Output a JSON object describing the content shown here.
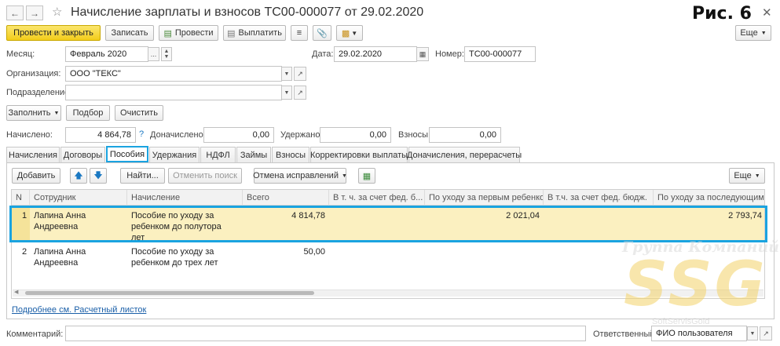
{
  "window": {
    "title": "Начисление зарплаты и взносов ТС00-000077 от 29.02.2020",
    "figure_label": "Рис. 6"
  },
  "toolbar": {
    "post_close": "Провести и закрыть",
    "save": "Записать",
    "post": "Провести",
    "pay": "Выплатить",
    "more": "Еще"
  },
  "header": {
    "month_label": "Месяц:",
    "month_value": "Февраль 2020",
    "date_label": "Дата:",
    "date_value": "29.02.2020",
    "number_label": "Номер:",
    "number_value": "ТС00-000077",
    "org_label": "Организация:",
    "org_value": "ООО \"ТЕКС\"",
    "dept_label": "Подразделение:",
    "dept_value": ""
  },
  "actions": {
    "fill": "Заполнить",
    "select": "Подбор",
    "clear": "Очистить"
  },
  "totals": {
    "accrued_label": "Начислено:",
    "accrued_value": "4 864,78",
    "help": "?",
    "additional_label": "Доначислено:",
    "additional_value": "0,00",
    "withheld_label": "Удержано:",
    "withheld_value": "0,00",
    "contributions_label": "Взносы:",
    "contributions_value": "0,00"
  },
  "tabs": [
    "Начисления",
    "Договоры",
    "Пособия",
    "Удержания",
    "НДФЛ",
    "Займы",
    "Взносы",
    "Корректировки выплаты",
    "Доначисления, перерасчеты"
  ],
  "table_toolbar": {
    "add": "Добавить",
    "find": "Найти...",
    "cancel_search": "Отменить поиск",
    "undo_fixes": "Отмена исправлений",
    "more": "Еще"
  },
  "table": {
    "columns": [
      "N",
      "Сотрудник",
      "Начисление",
      "Всего",
      "В т. ч. за счет фед. б...",
      "По уходу за первым ребенком",
      "В т.ч. за счет фед. бюдж.",
      "По уходу за последующими"
    ],
    "rows": [
      {
        "n": "1",
        "employee": "Лапина Анна Андреевна",
        "accrual": "Пособие по уходу за ребенком до полутора лет",
        "total": "4 814,78",
        "fed1": "",
        "first_child": "2 021,04",
        "fed2": "",
        "subsequent": "2 793,74"
      },
      {
        "n": "2",
        "employee": "Лапина Анна Андреевна",
        "accrual": "Пособие по уходу за ребенком до трех лет",
        "total": "50,00",
        "fed1": "",
        "first_child": "",
        "fed2": "",
        "subsequent": ""
      }
    ]
  },
  "footer": {
    "details_link": "Подробнее см. Расчетный листок",
    "comment_label": "Комментарий:",
    "comment_value": "",
    "responsible_label": "Ответственный:",
    "responsible_value": "ФИО пользователя"
  },
  "watermark": {
    "line1": "Группа Компаний",
    "line2": "SSG",
    "line3": "SoftServisGold"
  },
  "colors": {
    "accent_blue": "#1aa3e0",
    "yellow_button": "#f2cc1a",
    "selected_row": "#fbf0c0"
  },
  "icons": [
    "back-arrow-icon",
    "forward-arrow-icon",
    "star-icon",
    "document-icon",
    "list-icon",
    "paperclip-icon",
    "report-icon",
    "calendar-icon",
    "up-arrow-icon",
    "down-arrow-icon",
    "table-icon",
    "link-icon"
  ]
}
